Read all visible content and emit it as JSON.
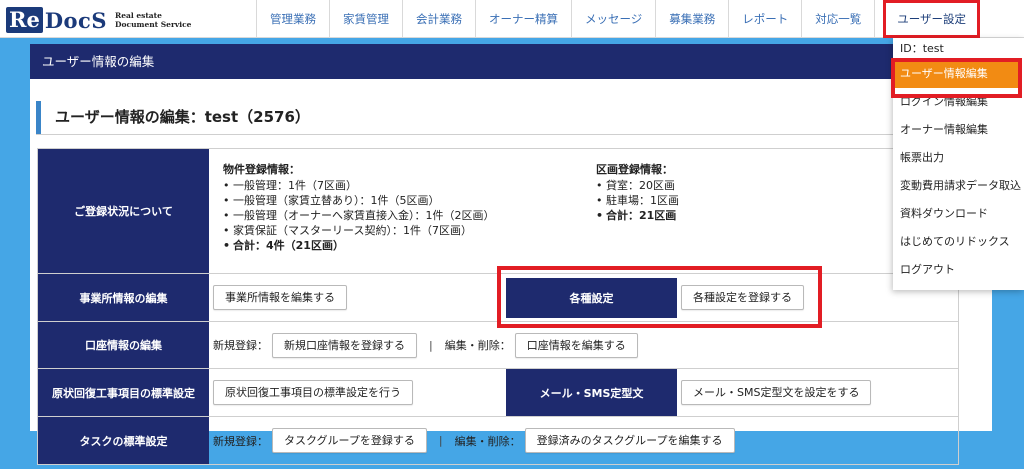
{
  "logo": {
    "mark_re": "Re",
    "mark_docs": "DocS",
    "tagline_1": "Real estate",
    "tagline_2": "Document Service"
  },
  "nav": [
    {
      "label": "管理業務"
    },
    {
      "label": "家賃管理"
    },
    {
      "label": "会計業務"
    },
    {
      "label": "オーナー精算"
    },
    {
      "label": "メッセージ"
    },
    {
      "label": "募集業務"
    },
    {
      "label": "レポート"
    },
    {
      "label": "対応一覧"
    },
    {
      "label": "ユーザー設定"
    }
  ],
  "page_header": "ユーザー情報の編集",
  "section_title": "ユーザー情報の編集：test（2576）",
  "status": {
    "heading": "ご登録状況について",
    "property": {
      "title": "物件登録情報：",
      "items": [
        "一般管理：1件（7区画）",
        "一般管理（家賃立替あり）：1件（5区画）",
        "一般管理（オーナーへ家賃直接入金）：1件（2区画）",
        "家賃保証（マスターリース契約）：1件（7区画）"
      ],
      "total": "合計：4件（21区画）"
    },
    "units": {
      "title": "区画登録情報：",
      "items": [
        "貸室：20区画",
        "駐車場：1区画"
      ],
      "total": "合計：21区画"
    }
  },
  "rows": {
    "office": {
      "heading": "事業所情報の編集",
      "button": "事業所情報を編集する"
    },
    "settings": {
      "heading": "各種設定",
      "button": "各種設定を登録する"
    },
    "account": {
      "heading": "口座情報の編集",
      "new_label": "新規登録：",
      "new_button": "新規口座情報を登録する",
      "separator": "|",
      "edit_label": "編集・削除：",
      "edit_button": "口座情報を編集する"
    },
    "restoration": {
      "heading": "原状回復工事項目の標準設定",
      "button": "原状回復工事項目の標準設定を行う"
    },
    "mail": {
      "heading": "メール・SMS定型文",
      "button": "メール・SMS定型文を設定をする"
    },
    "task": {
      "heading": "タスクの標準設定",
      "new_label": "新規登録：",
      "new_button": "タスクグループを登録する",
      "separator": "|",
      "edit_label": "編集・削除：",
      "edit_button": "登録済みのタスクグループを編集する"
    }
  },
  "dropdown": {
    "id_label": "ID：test",
    "items": [
      "ユーザー情報編集",
      "ログイン情報編集",
      "オーナー情報編集",
      "帳票出力",
      "変動費用請求データ取込",
      "資料ダウンロード",
      "はじめてのリドックス",
      "ログアウト"
    ],
    "selected_index": 0
  },
  "colors": {
    "navy": "#1e2a6e",
    "frame_blue": "#45a6e6",
    "highlight_red": "#e21d24",
    "selected_orange": "#f28b13",
    "nav_link": "#3a6fb5"
  }
}
